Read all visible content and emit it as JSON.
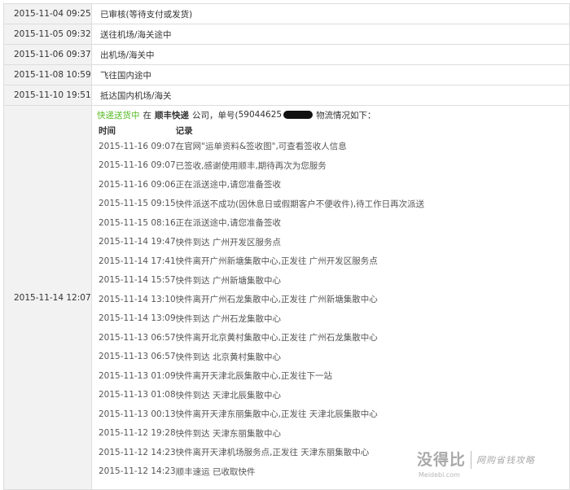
{
  "status_rows": [
    {
      "time": "2015-11-04 09:25",
      "status": "已审核(等待支付或发货)"
    },
    {
      "time": "2015-11-05 09:32",
      "status": "送往机场/海关途中"
    },
    {
      "time": "2015-11-06 09:37",
      "status": "出机场/海关中"
    },
    {
      "time": "2015-11-08 10:59",
      "status": "飞往国内途中"
    },
    {
      "time": "2015-11-10 19:51",
      "status": "抵达国内机场/海关"
    }
  ],
  "delivery": {
    "time": "2015-11-14 12:07",
    "headline": {
      "label": "快递送货中",
      "prefix": "在",
      "company": "顺丰快递",
      "mid": "公司，单号(",
      "tracking_partial": "59044625",
      "suffix": "物流情况如下："
    },
    "columns": {
      "time": "时间",
      "record": "记录"
    },
    "records": [
      {
        "time": "2015-11-16 09:07",
        "text": "在官网\"运单资料&签收图\",可查看签收人信息"
      },
      {
        "time": "2015-11-16 09:07",
        "text": "已签收,感谢使用顺丰,期待再次为您服务"
      },
      {
        "time": "2015-11-16 09:06",
        "text": "正在派送途中,请您准备签收"
      },
      {
        "time": "2015-11-15 09:15",
        "text": "快件派送不成功(因休息日或假期客户不便收件),待工作日再次派送"
      },
      {
        "time": "2015-11-15 08:16",
        "text": "正在派送途中,请您准备签收"
      },
      {
        "time": "2015-11-14 19:47",
        "text": "快件到达 广州开发区服务点"
      },
      {
        "time": "2015-11-14 17:41",
        "text": "快件离开广州新塘集散中心,正发往 广州开发区服务点"
      },
      {
        "time": "2015-11-14 15:57",
        "text": "快件到达 广州新塘集散中心"
      },
      {
        "time": "2015-11-14 13:10",
        "text": "快件离开广州石龙集散中心,正发往 广州新塘集散中心"
      },
      {
        "time": "2015-11-14 13:09",
        "text": "快件到达 广州石龙集散中心"
      },
      {
        "time": "2015-11-13 06:57",
        "text": "快件离开北京黄村集散中心,正发往 广州石龙集散中心"
      },
      {
        "time": "2015-11-13 06:57",
        "text": "快件到达 北京黄村集散中心"
      },
      {
        "time": "2015-11-13 01:09",
        "text": "快件离开天津北辰集散中心,正发往下一站"
      },
      {
        "time": "2015-11-13 01:08",
        "text": "快件到达 天津北辰集散中心"
      },
      {
        "time": "2015-11-13 00:13",
        "text": "快件离开天津东丽集散中心,正发往 天津北辰集散中心"
      },
      {
        "time": "2015-11-12 19:28",
        "text": "快件到达 天津东丽集散中心"
      },
      {
        "time": "2015-11-12 14:23",
        "text": "快件离开天津机场服务点,正发往 天津东丽集散中心"
      },
      {
        "time": "2015-11-12 14:23",
        "text": "顺丰速运 已收取快件"
      }
    ]
  },
  "watermark": {
    "main": "没得比",
    "domain": "Meidebi.com",
    "slogan": "网购省钱攻略"
  }
}
